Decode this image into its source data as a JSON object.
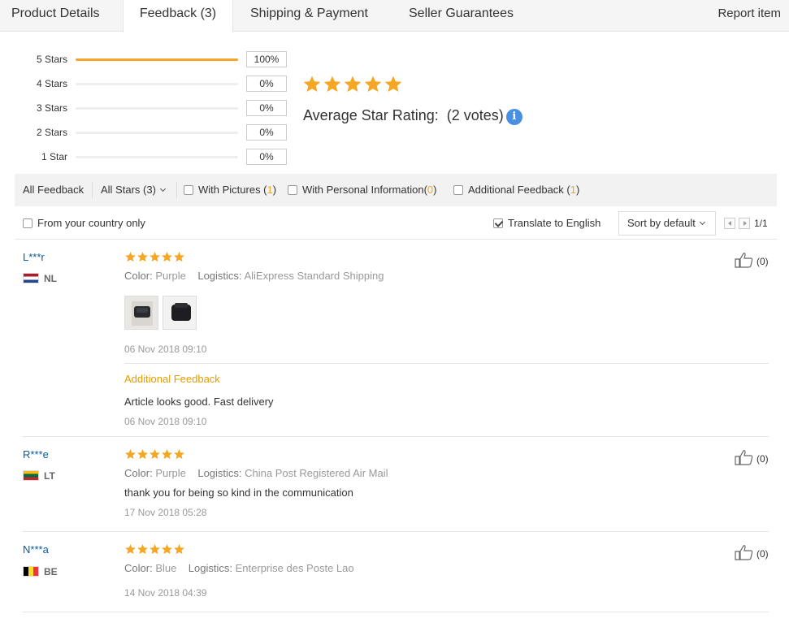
{
  "tabs": [
    {
      "label": "Product Details"
    },
    {
      "label": "Feedback (3)"
    },
    {
      "label": "Shipping & Payment"
    },
    {
      "label": "Seller Guarantees"
    }
  ],
  "report_label": "Report item",
  "rating_breakdown": [
    {
      "label": "5 Stars",
      "percent": "100%",
      "fraction": 1.0
    },
    {
      "label": "4 Stars",
      "percent": "0%",
      "fraction": 0
    },
    {
      "label": "3 Stars",
      "percent": "0%",
      "fraction": 0
    },
    {
      "label": "2 Stars",
      "percent": "0%",
      "fraction": 0
    },
    {
      "label": "1 Star",
      "percent": "0%",
      "fraction": 0
    }
  ],
  "average": {
    "stars": 5,
    "label": "Average Star Rating:",
    "votes": "(2 votes)",
    "info_icon": "info-icon"
  },
  "filters": {
    "all_feedback": "All Feedback",
    "all_stars": "All Stars (3)",
    "with_pictures": {
      "label": "With Pictures (",
      "count": "1",
      "close": ")"
    },
    "with_personal": {
      "label": "With Personal Information(",
      "count": "0",
      "close": ")"
    },
    "additional": {
      "label": "Additional Feedback (",
      "count": "1",
      "close": ")"
    }
  },
  "options": {
    "country_only": "From your country only",
    "translate": "Translate to English",
    "translate_checked": true,
    "sort": "Sort by default",
    "page": "1/1"
  },
  "colors": {
    "accent": "#f5a623",
    "link": "#0a5a9c",
    "info": "#4a90e2"
  },
  "reviews": [
    {
      "name": "L***r",
      "country": "NL",
      "stars": 5,
      "color_label": "Color:",
      "color": "Purple",
      "logistics_label": "Logistics:",
      "logistics": "AliExpress Standard Shipping",
      "date": "06 Nov 2018 09:10",
      "additional_title": "Additional Feedback",
      "additional_text": "Article looks good. Fast delivery",
      "additional_date": "06 Nov 2018 09:10",
      "likes": "(0)"
    },
    {
      "name": "R***e",
      "country": "LT",
      "stars": 5,
      "color_label": "Color:",
      "color": "Purple",
      "logistics_label": "Logistics:",
      "logistics": "China Post Registered Air Mail",
      "text": "thank you for being so kind in the communication",
      "date": "17 Nov 2018 05:28",
      "likes": "(0)"
    },
    {
      "name": "N***a",
      "country": "BE",
      "stars": 5,
      "color_label": "Color:",
      "color": "Blue",
      "logistics_label": "Logistics:",
      "logistics": "Enterprise des Poste Lao",
      "date": "14 Nov 2018 04:39",
      "likes": "(0)"
    }
  ]
}
